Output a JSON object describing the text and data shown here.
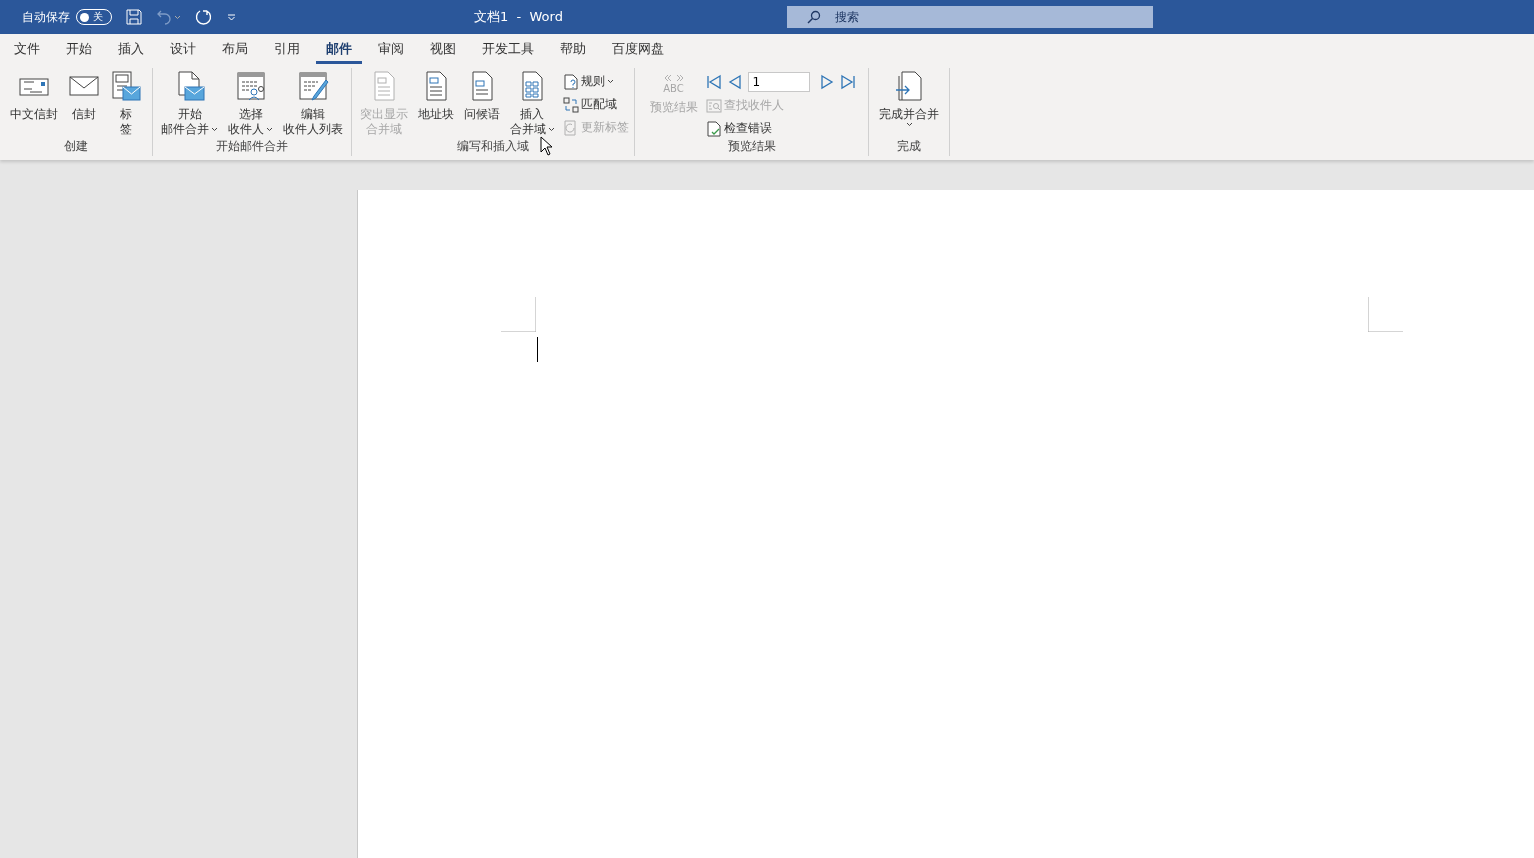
{
  "title_bar": {
    "autosave_label": "自动保存",
    "autosave_toggle": {
      "on": false,
      "label": "关"
    },
    "quick_access": [
      {
        "kind": "save",
        "disabled": false
      },
      {
        "kind": "undo",
        "disabled": true
      },
      {
        "kind": "redo",
        "disabled": false
      },
      {
        "kind": "customize",
        "disabled": false
      }
    ],
    "title": "文档1  -  Word",
    "search": {
      "placeholder": "搜索"
    }
  },
  "tabs": [
    {
      "label": "文件",
      "selected": false
    },
    {
      "label": "开始",
      "selected": false
    },
    {
      "label": "插入",
      "selected": false
    },
    {
      "label": "设计",
      "selected": false
    },
    {
      "label": "布局",
      "selected": false
    },
    {
      "label": "引用",
      "selected": false
    },
    {
      "label": "邮件",
      "selected": true
    },
    {
      "label": "审阅",
      "selected": false
    },
    {
      "label": "视图",
      "selected": false
    },
    {
      "label": "开发工具",
      "selected": false
    },
    {
      "label": "帮助",
      "selected": false
    },
    {
      "label": "百度网盘",
      "selected": false
    }
  ],
  "ribbon": {
    "groups": [
      {
        "name": "创建",
        "items": [
          {
            "kind": "large",
            "lines": [
              "中文信封"
            ],
            "dropdown": false,
            "disabled": false
          },
          {
            "kind": "large",
            "lines": [
              "信封"
            ],
            "dropdown": false,
            "disabled": false
          },
          {
            "kind": "large",
            "lines": [
              "标",
              "签"
            ],
            "dropdown": false,
            "disabled": false
          }
        ]
      },
      {
        "name": "开始邮件合并",
        "items": [
          {
            "kind": "large",
            "lines": [
              "开始",
              "邮件合并"
            ],
            "dropdown": true,
            "disabled": false
          },
          {
            "kind": "large",
            "lines": [
              "选择",
              "收件人"
            ],
            "dropdown": true,
            "disabled": false
          },
          {
            "kind": "large",
            "lines": [
              "编辑",
              "收件人列表"
            ],
            "dropdown": false,
            "disabled": false
          }
        ]
      },
      {
        "name": "编写和插入域",
        "items": [
          {
            "kind": "large",
            "lines": [
              "突出显示",
              "合并域"
            ],
            "dropdown": false,
            "disabled": true
          },
          {
            "kind": "large",
            "lines": [
              "地址块"
            ],
            "dropdown": false,
            "disabled": false
          },
          {
            "kind": "large",
            "lines": [
              "问候语"
            ],
            "dropdown": false,
            "disabled": false
          },
          {
            "kind": "large",
            "lines": [
              "插入",
              "合并域"
            ],
            "dropdown": true,
            "disabled": false
          },
          {
            "kind": "stack",
            "items": [
              {
                "kind": "small",
                "label": "规则",
                "dropdown": true,
                "disabled": false
              },
              {
                "kind": "small",
                "label": "匹配域",
                "dropdown": false,
                "disabled": false
              },
              {
                "kind": "small",
                "label": "更新标签",
                "dropdown": false,
                "disabled": true
              }
            ]
          }
        ]
      },
      {
        "name": "预览结果",
        "items": [
          {
            "kind": "large",
            "lines": [
              "预览结果"
            ],
            "icon_text": "ABC",
            "dropdown": false,
            "disabled": true
          },
          {
            "kind": "stack",
            "items": [
              {
                "kind": "nav",
                "record": "1"
              },
              {
                "kind": "small",
                "label": "查找收件人",
                "dropdown": false,
                "disabled": true
              },
              {
                "kind": "small",
                "label": "检查错误",
                "dropdown": false,
                "disabled": false
              }
            ]
          }
        ]
      },
      {
        "name": "完成",
        "items": [
          {
            "kind": "large",
            "lines": [
              "完成并合并"
            ],
            "dropdown": true,
            "disabled": false
          }
        ]
      }
    ]
  }
}
